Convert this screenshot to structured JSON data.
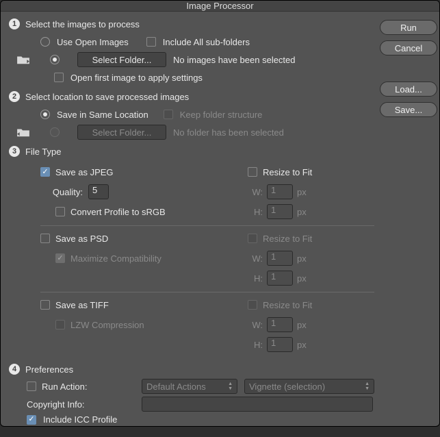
{
  "title": "Image Processor",
  "buttons": {
    "run": "Run",
    "cancel": "Cancel",
    "load": "Load...",
    "save": "Save..."
  },
  "section1": {
    "title": "Select the images to process",
    "use_open_images": "Use Open Images",
    "include_subfolders": "Include All sub-folders",
    "select_folder": "Select Folder...",
    "no_images": "No images have been selected",
    "open_first": "Open first image to apply settings"
  },
  "section2": {
    "title": "Select location to save processed images",
    "same_location": "Save in Same Location",
    "keep_folder": "Keep folder structure",
    "select_folder": "Select Folder...",
    "no_folder": "No folder has been selected"
  },
  "section3": {
    "title": "File Type",
    "jpeg": {
      "label": "Save as JPEG",
      "quality_label": "Quality:",
      "quality_value": "5",
      "convert_srgb": "Convert Profile to sRGB",
      "resize": "Resize to Fit",
      "w": "W:",
      "h": "H:",
      "px": "px",
      "w_val": "1",
      "h_val": "1"
    },
    "psd": {
      "label": "Save as PSD",
      "max_compat": "Maximize Compatibility",
      "resize": "Resize to Fit",
      "w": "W:",
      "h": "H:",
      "px": "px",
      "w_val": "1",
      "h_val": "1"
    },
    "tiff": {
      "label": "Save as TIFF",
      "lzw": "LZW Compression",
      "resize": "Resize to Fit",
      "w": "W:",
      "h": "H:",
      "px": "px",
      "w_val": "1",
      "h_val": "1"
    }
  },
  "section4": {
    "title": "Preferences",
    "run_action": "Run Action:",
    "action_set": "Default Actions",
    "action_name": "Vignette (selection)",
    "copyright": "Copyright Info:",
    "copyright_value": "",
    "icc": "Include ICC Profile"
  }
}
